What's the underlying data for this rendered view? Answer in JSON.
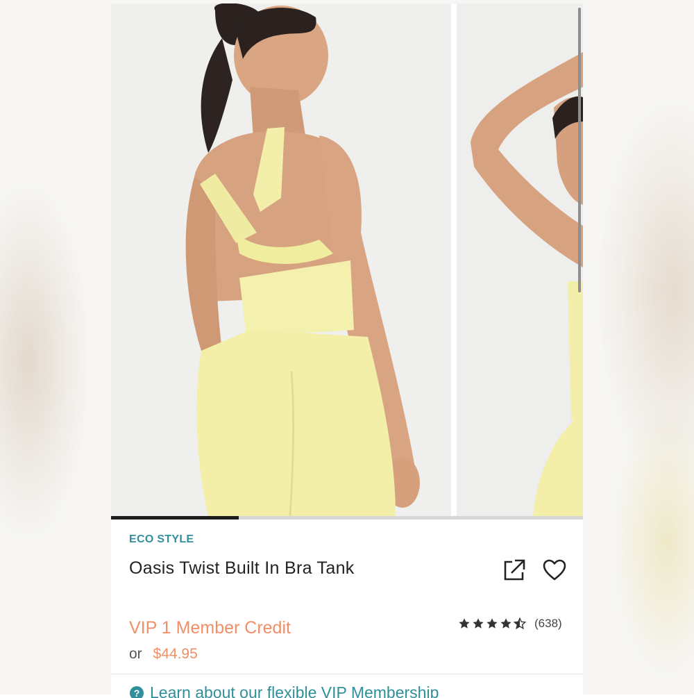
{
  "product": {
    "badge": "ECO STYLE",
    "title": "Oasis Twist Built In Bra Tank",
    "vip_price": "VIP 1 Member Credit",
    "or_text": "or",
    "price": "$44.95",
    "rating_stars": 4.5,
    "review_count": "(638)"
  },
  "carousel": {
    "progress_fraction": 0.27,
    "slides": [
      {
        "image": "model-back-view-yellow-tank"
      },
      {
        "image": "model-arm-raised-yellow-tank"
      }
    ]
  },
  "membership_link": {
    "label": "Learn about our flexible VIP Membership",
    "icon": "question-circle-icon"
  },
  "icons": {
    "share": "share-external-icon",
    "favorite": "heart-outline-icon"
  },
  "colors": {
    "accent_teal": "#2f8f9b",
    "price_orange": "#ef8f68",
    "garment_yellow": "#f3efaa"
  }
}
